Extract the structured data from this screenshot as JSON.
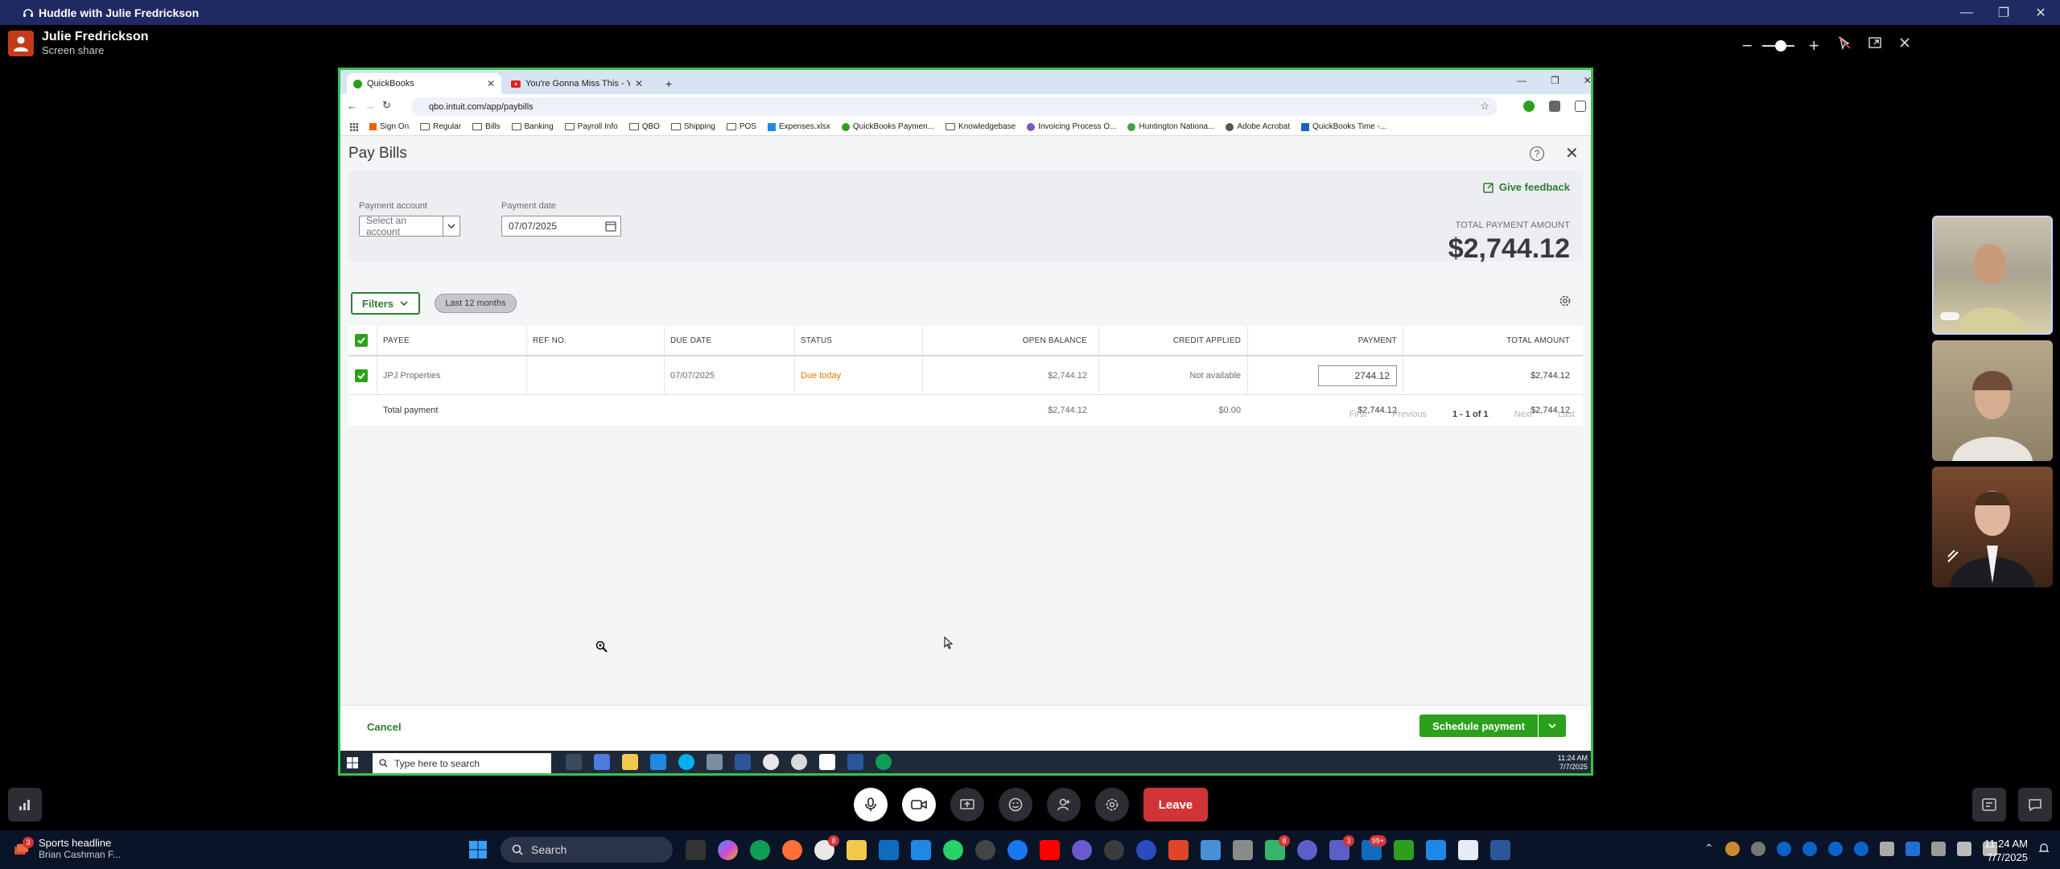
{
  "huddle": {
    "title": "Huddle with Julie Fredrickson"
  },
  "presenter": {
    "name": "Julie Fredrickson",
    "status": "Screen share"
  },
  "browser": {
    "tabs": [
      {
        "label": "QuickBooks",
        "active": true
      },
      {
        "label": "You're Gonna Miss This - YouTu",
        "active": false
      }
    ],
    "url": "qbo.intuit.com/app/paybills",
    "bookmarks": [
      "Sign On",
      "Regular",
      "Bills",
      "Banking",
      "Payroll Info",
      "QBO",
      "Shipping",
      "POS",
      "Expenses.xlsx",
      "QuickBooks Paymen...",
      "Knowledgebase",
      "Invoicing Process O...",
      "Huntington Nationa...",
      "Adobe Acrobat",
      "QuickBooks Time -..."
    ]
  },
  "paybills": {
    "title": "Pay Bills",
    "feedback": "Give feedback",
    "payment_account_label": "Payment account",
    "payment_account_placeholder": "Select an account",
    "payment_date_label": "Payment date",
    "payment_date": "07/07/2025",
    "total_payment_label": "TOTAL PAYMENT AMOUNT",
    "total_payment": "$2,744.12",
    "filters": "Filters",
    "period": "Last 12 months",
    "columns": {
      "payee": "PAYEE",
      "ref": "REF NO.",
      "due": "DUE DATE",
      "status": "STATUS",
      "open": "OPEN BALANCE",
      "credit": "CREDIT APPLIED",
      "payment": "PAYMENT",
      "total": "TOTAL AMOUNT"
    },
    "rows": [
      {
        "payee": "JPJ Properties",
        "ref": "",
        "due": "07/07/2025",
        "status": "Due today",
        "open": "$2,744.12",
        "credit": "Not available",
        "payment": "2744.12",
        "total": "$2,744.12"
      }
    ],
    "totals": {
      "label": "Total payment",
      "open": "$2,744.12",
      "credit": "$0.00",
      "payment": "$2,744.12",
      "total": "$2,744.12"
    },
    "pager": {
      "first": "First",
      "previous": "Previous",
      "range": "1 - 1 of 1",
      "next": "Next",
      "last": "Last"
    },
    "cancel": "Cancel",
    "schedule": "Schedule payment"
  },
  "inner_taskbar": {
    "search_placeholder": "Type here to search",
    "time": "11:24 AM",
    "date": "7/7/2025"
  },
  "controls": {
    "leave": "Leave"
  },
  "taskbar": {
    "news_title": "Sports headline",
    "news_sub": "Brian Cashman F...",
    "news_badge": "3",
    "search": "Search",
    "badges": {
      "teams": "8",
      "chat": "3",
      "mail": "99+"
    },
    "time": "11:24 AM",
    "date": "7/7/2025"
  },
  "colors": {
    "accent_green": "#2ca01c",
    "teams_bar": "#1f2a63",
    "leave_red": "#d13438",
    "due_today": "#e07b00"
  }
}
